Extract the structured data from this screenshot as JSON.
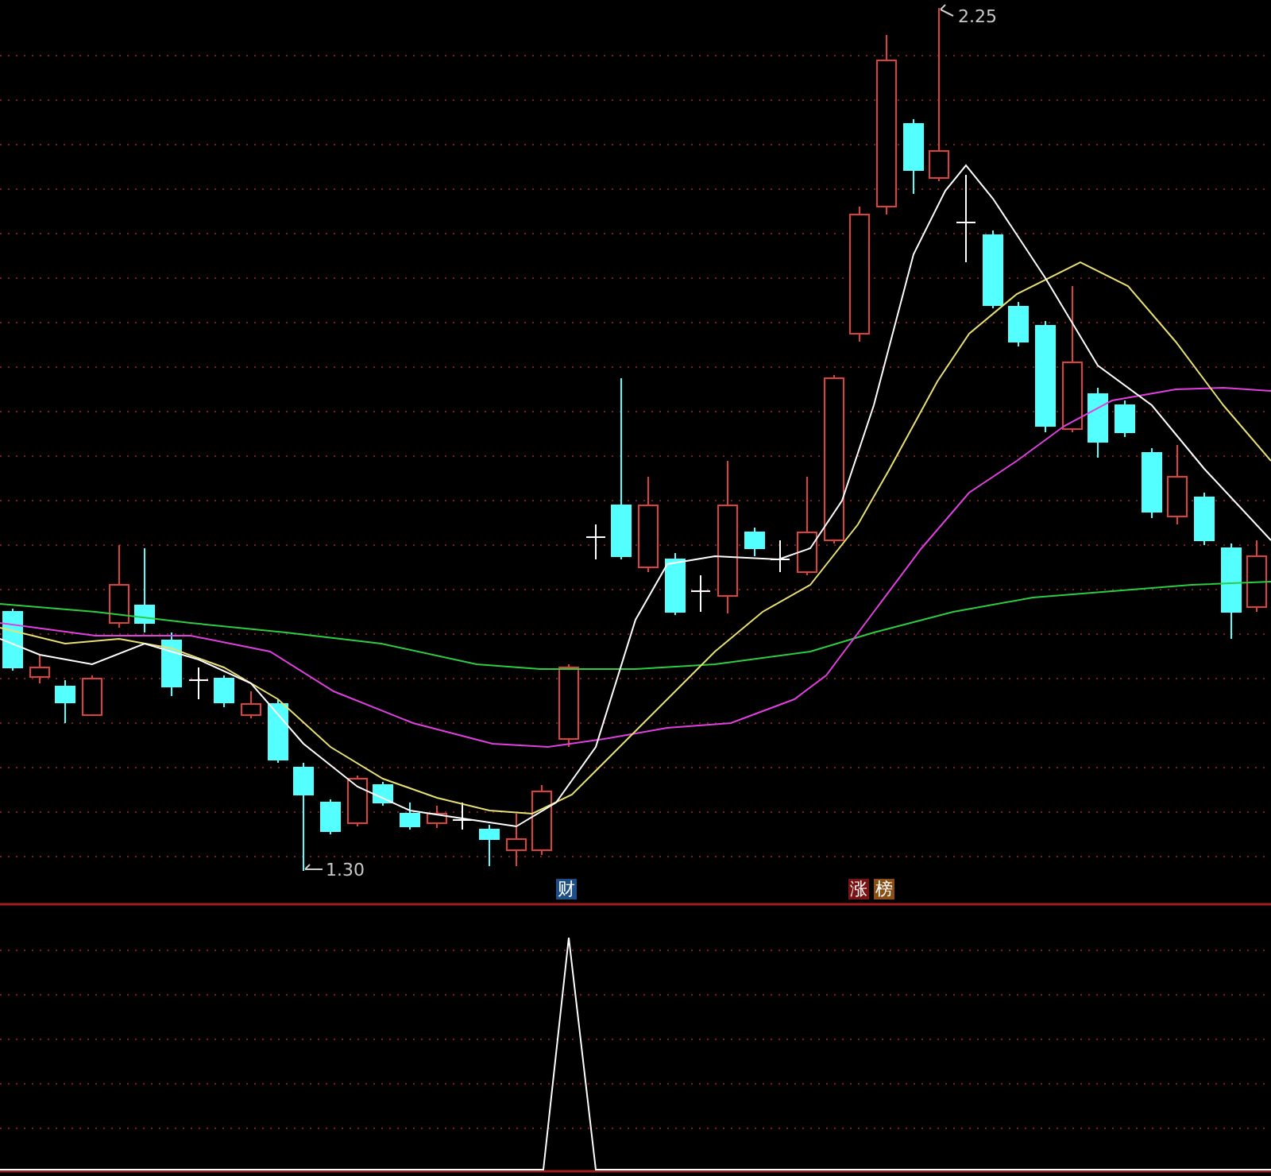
{
  "price_chart": {
    "high_label": "2.25",
    "low_label": "1.30"
  },
  "markers": [
    {
      "text": "财",
      "color": "#1d4f86"
    },
    {
      "text": "涨",
      "color": "#7a1414"
    },
    {
      "text": "榜",
      "color": "#8a4f14"
    }
  ]
}
